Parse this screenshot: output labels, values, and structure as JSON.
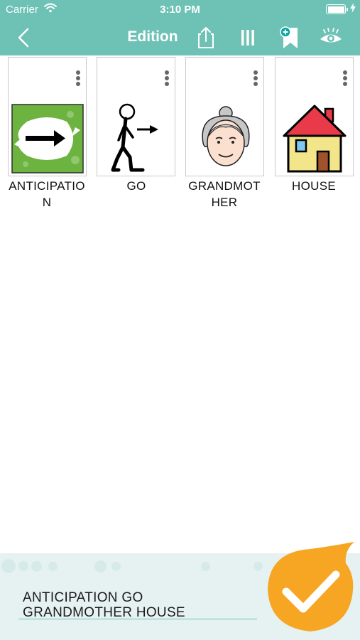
{
  "status": {
    "carrier": "Carrier",
    "time": "3:10 PM"
  },
  "nav": {
    "title": "Edition"
  },
  "cards": [
    {
      "label": "ANTICIPATION",
      "lines": [
        "ANTICIPATIO",
        "N"
      ]
    },
    {
      "label": "GO",
      "lines": [
        "GO",
        ""
      ]
    },
    {
      "label": "GRANDMOTHER",
      "lines": [
        "GRANDMOT",
        "HER"
      ]
    },
    {
      "label": "HOUSE",
      "lines": [
        "HOUSE",
        ""
      ]
    }
  ],
  "sentence": {
    "line1": "ANTICIPATION GO",
    "line2": "GRANDMOTHER HOUSE"
  },
  "colors": {
    "accent": "#6dc1b5",
    "confirm": "#f6a623",
    "footer": "#e6f2f2"
  },
  "icons": [
    "back-chevron-icon",
    "share-icon",
    "columns-icon",
    "add-bookmark-icon",
    "eye-icon",
    "more-vertical-icon",
    "checkmark-icon"
  ]
}
